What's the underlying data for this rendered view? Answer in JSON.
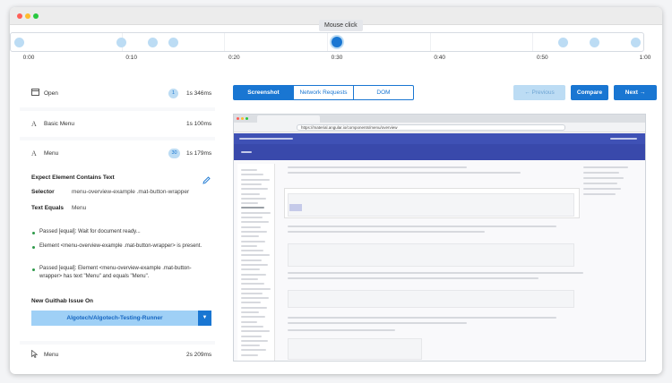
{
  "tooltip": "Mouse click",
  "timeline": {
    "ticks": [
      "0:00",
      "0:10",
      "0:20",
      "0:30",
      "0:40",
      "0:50",
      "1:00"
    ],
    "markers_seconds": [
      0,
      10,
      13,
      15,
      31,
      53,
      56,
      60
    ],
    "active_seconds": 31
  },
  "steps": [
    {
      "icon": "window-icon",
      "label": "Open",
      "badge": "1",
      "duration": "1s 346ms"
    },
    {
      "icon": "text-icon",
      "label": "Basic Menu",
      "duration": "1s 100ms"
    },
    {
      "icon": "text-icon",
      "label": "Menu",
      "badge": "30",
      "duration": "1s 179ms"
    },
    {
      "icon": "cursor-icon",
      "label": "Menu",
      "duration": "2s 209ms"
    }
  ],
  "expect": {
    "title": "Expect Element Contains Text",
    "selector_label": "Selector",
    "selector_value": "menu-overview-example .mat-button-wrapper",
    "text_equals_label": "Text Equals",
    "text_equals_value": "Menu"
  },
  "logs": [
    "Passed [equal]: Wait for document ready...",
    "Element <menu-overview-example .mat-button-wrapper> is present.",
    "Passed [equal]: Element <menu-overview-example .mat-button-wrapper> has text \"Menu\" and equals \"Menu\"."
  ],
  "github": {
    "title": "New Guithab Issue On",
    "repo": "Algotech/Algotech-Testing-Runner"
  },
  "tabs": [
    "Screenshot",
    "Network Requests",
    "DOM"
  ],
  "buttons": {
    "previous": "Previous",
    "compare": "Compare",
    "next": "Next"
  },
  "screenshot": {
    "url": "https://material.angular.io/components/menu/overview"
  },
  "colors": {
    "accent": "#1976d2",
    "accent_light": "#bcdcf4",
    "material_indigo": "#3f51b5"
  }
}
